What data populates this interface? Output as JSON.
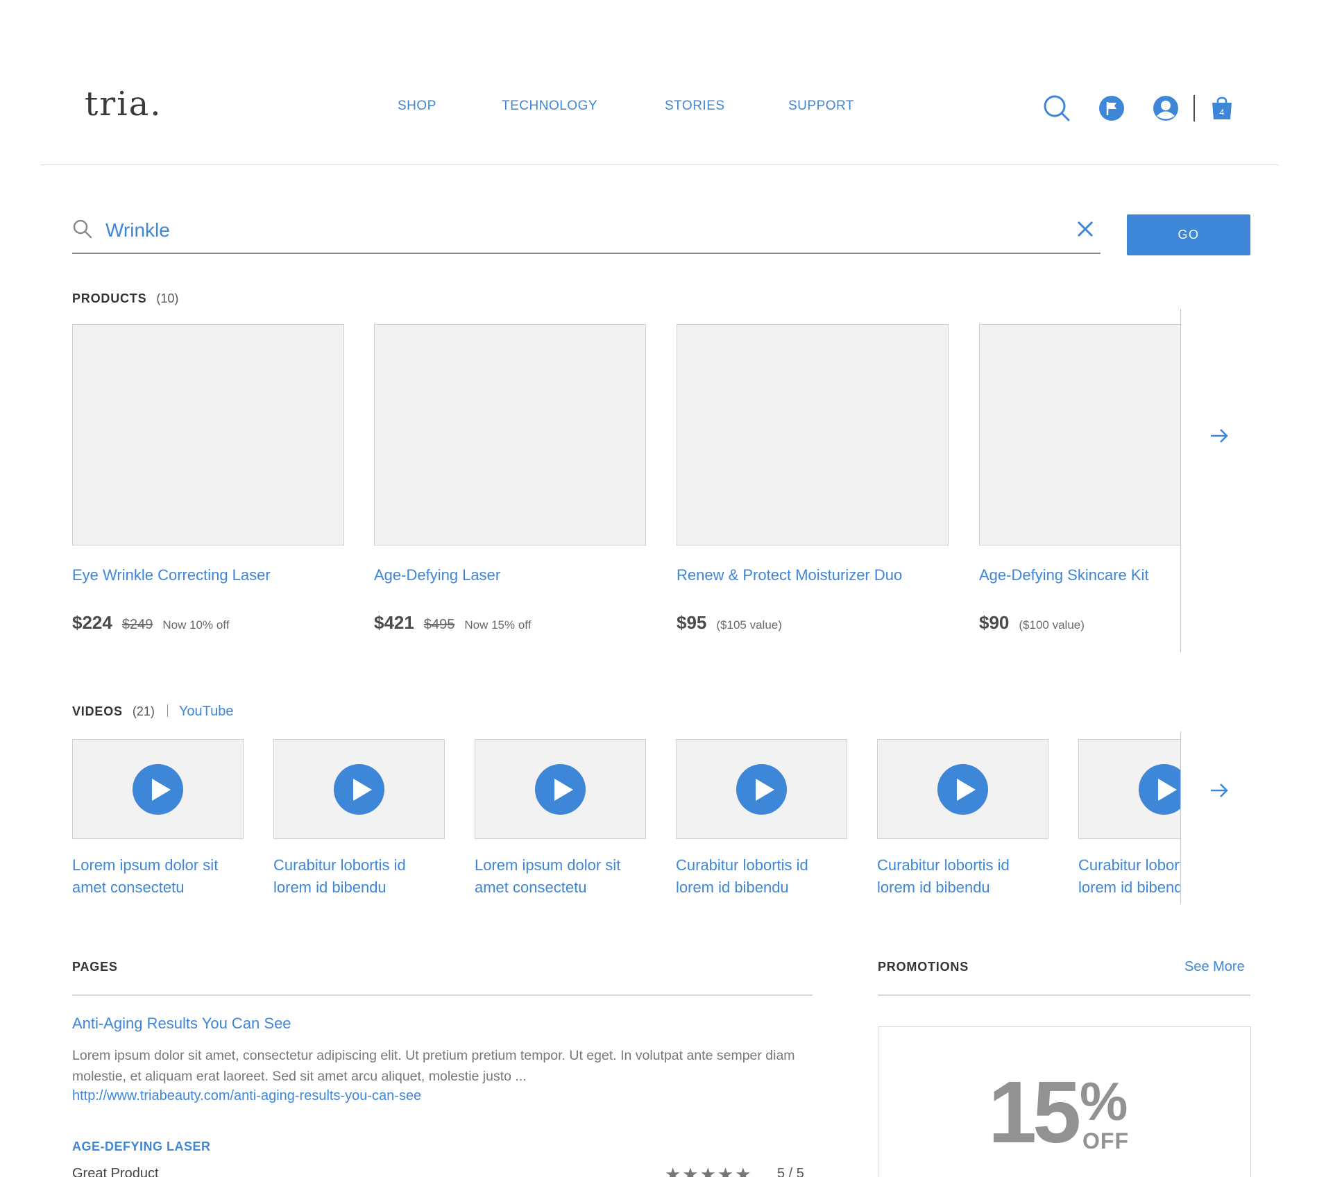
{
  "header": {
    "logo": "tria.",
    "nav": [
      "SHOP",
      "TECHNOLOGY",
      "STORIES",
      "SUPPORT"
    ],
    "cart_count": "4"
  },
  "search": {
    "value": "Wrinkle",
    "go_label": "GO"
  },
  "products": {
    "heading": "PRODUCTS",
    "count": "(10)",
    "items": [
      {
        "name": "Eye Wrinkle Correcting Laser",
        "price": "$224",
        "original": "$249",
        "note": "Now 10% off"
      },
      {
        "name": "Age-Defying Laser",
        "price": "$421",
        "original": "$495",
        "note": "Now 15% off"
      },
      {
        "name": "Renew & Protect Moisturizer Duo",
        "price": "$95",
        "original": "",
        "note": "($105 value)"
      },
      {
        "name": "Age-Defying Skincare Kit",
        "price": "$90",
        "original": "",
        "note": "($100 value)"
      }
    ]
  },
  "videos": {
    "heading": "VIDEOS",
    "count": "(21)",
    "source_link": "YouTube",
    "items": [
      {
        "title": "Lorem ipsum dolor sit amet consectetu"
      },
      {
        "title": "Curabitur lobortis id lorem id bibendu"
      },
      {
        "title": "Lorem ipsum dolor sit amet consectetu"
      },
      {
        "title": "Curabitur lobortis id lorem id bibendu"
      },
      {
        "title": "Curabitur lobortis id lorem id bibendu"
      },
      {
        "title": "Curabitur lobortis id lorem id bibendu"
      }
    ]
  },
  "pages": {
    "heading": "PAGES",
    "result": {
      "title": "Anti-Aging Results You Can See",
      "description": "Lorem ipsum dolor sit amet, consectetur adipiscing elit. Ut pretium pretium tempor. Ut eget. In volutpat ante semper diam molestie, et aliquam erat laoreet. Sed sit amet arcu aliquet, molestie justo ...",
      "url": "http://www.triabeauty.com/anti-aging-results-you-can-see"
    },
    "reviews": {
      "product": "AGE-DEFYING LASER",
      "review_title": "Great Product",
      "stars": "★★★★★",
      "rating_text": "5 / 5"
    }
  },
  "promotions": {
    "heading": "PROMOTIONS",
    "see_more": "See More",
    "promo": {
      "number": "15",
      "percent": "%",
      "off": "OFF"
    }
  },
  "colors": {
    "accent": "#3d86d8",
    "placeholder_bg": "#f2f2f2"
  }
}
